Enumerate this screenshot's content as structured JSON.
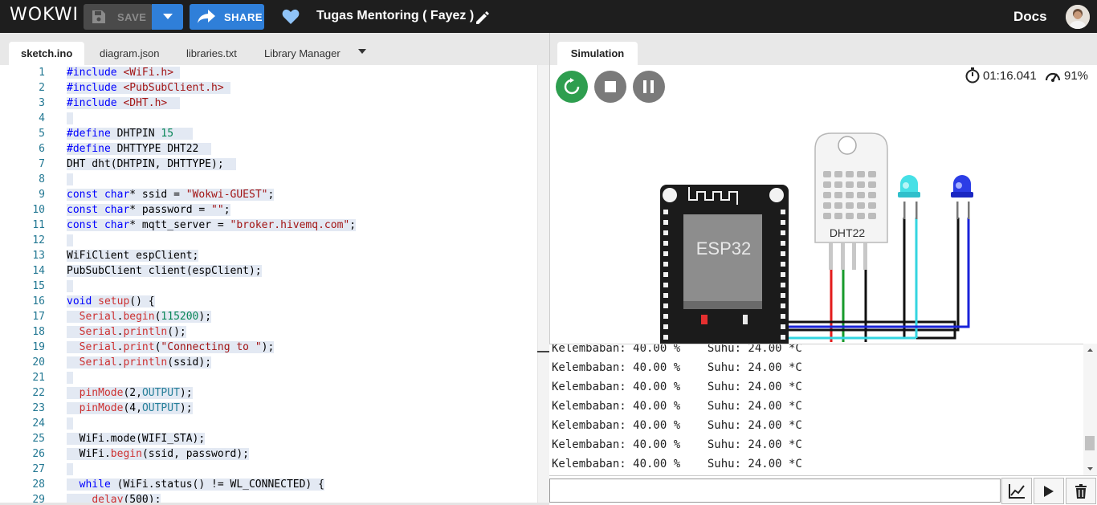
{
  "header": {
    "logo": "WOKWI",
    "save_label": "SAVE",
    "share_label": "SHARE",
    "project_title": "Tugas Mentoring ( Fayez )",
    "docs_label": "Docs"
  },
  "editor_tabs": [
    {
      "label": "sketch.ino",
      "active": true
    },
    {
      "label": "diagram.json",
      "active": false
    },
    {
      "label": "libraries.txt",
      "active": false
    },
    {
      "label": "Library Manager",
      "active": false
    }
  ],
  "code_lines": [
    {
      "n": "1",
      "segs": [
        [
          "kw",
          "#include"
        ],
        [
          "",
          " "
        ],
        [
          "str",
          "<WiFi.h>"
        ],
        [
          "",
          " "
        ]
      ]
    },
    {
      "n": "2",
      "segs": [
        [
          "kw",
          "#include"
        ],
        [
          "",
          " "
        ],
        [
          "str",
          "<PubSubClient.h>"
        ],
        [
          "",
          " "
        ]
      ]
    },
    {
      "n": "3",
      "segs": [
        [
          "kw",
          "#include"
        ],
        [
          "",
          " "
        ],
        [
          "str",
          "<DHT.h>"
        ],
        [
          "",
          "  "
        ]
      ]
    },
    {
      "n": "4",
      "segs": [
        [
          "",
          " "
        ]
      ]
    },
    {
      "n": "5",
      "segs": [
        [
          "kw",
          "#define"
        ],
        [
          "",
          " DHTPIN "
        ],
        [
          "num",
          "15"
        ],
        [
          "",
          "   "
        ]
      ]
    },
    {
      "n": "6",
      "segs": [
        [
          "kw",
          "#define"
        ],
        [
          "",
          " DHTTYPE DHT22  "
        ]
      ]
    },
    {
      "n": "7",
      "segs": [
        [
          "",
          "DHT dht(DHTPIN, DHTTYPE);  "
        ]
      ]
    },
    {
      "n": "8",
      "segs": [
        [
          "",
          " "
        ]
      ]
    },
    {
      "n": "9",
      "segs": [
        [
          "kw",
          "const"
        ],
        [
          "",
          " "
        ],
        [
          "kw",
          "char"
        ],
        [
          "",
          "* ssid = "
        ],
        [
          "str",
          "\"Wokwi-GUEST\""
        ],
        [
          "",
          ";"
        ]
      ]
    },
    {
      "n": "10",
      "segs": [
        [
          "kw",
          "const"
        ],
        [
          "",
          " "
        ],
        [
          "kw",
          "char"
        ],
        [
          "",
          "* password = "
        ],
        [
          "str",
          "\"\""
        ],
        [
          "",
          ";"
        ]
      ]
    },
    {
      "n": "11",
      "segs": [
        [
          "kw",
          "const"
        ],
        [
          "",
          " "
        ],
        [
          "kw",
          "char"
        ],
        [
          "",
          "* mqtt_server = "
        ],
        [
          "str",
          "\"broker.hivemq.com\""
        ],
        [
          "",
          ";"
        ]
      ]
    },
    {
      "n": "12",
      "segs": [
        [
          "",
          " "
        ]
      ]
    },
    {
      "n": "13",
      "segs": [
        [
          "",
          "WiFiClient espClient;"
        ]
      ]
    },
    {
      "n": "14",
      "segs": [
        [
          "",
          "PubSubClient client(espClient);"
        ]
      ]
    },
    {
      "n": "15",
      "segs": [
        [
          "",
          " "
        ]
      ]
    },
    {
      "n": "16",
      "segs": [
        [
          "kw",
          "void"
        ],
        [
          "",
          " "
        ],
        [
          "fn",
          "setup"
        ],
        [
          "",
          "() {"
        ]
      ]
    },
    {
      "n": "17",
      "segs": [
        [
          "",
          "  "
        ],
        [
          "fn",
          "Serial"
        ],
        [
          "",
          "."
        ],
        [
          "fn",
          "begin"
        ],
        [
          "",
          "("
        ],
        [
          "num",
          "115200"
        ],
        [
          "",
          ");"
        ]
      ]
    },
    {
      "n": "18",
      "segs": [
        [
          "",
          "  "
        ],
        [
          "fn",
          "Serial"
        ],
        [
          "",
          "."
        ],
        [
          "fn",
          "println"
        ],
        [
          "",
          "();"
        ]
      ]
    },
    {
      "n": "19",
      "segs": [
        [
          "",
          "  "
        ],
        [
          "fn",
          "Serial"
        ],
        [
          "",
          "."
        ],
        [
          "fn",
          "print"
        ],
        [
          "",
          "("
        ],
        [
          "str",
          "\"Connecting to \""
        ],
        [
          "",
          ");"
        ]
      ]
    },
    {
      "n": "20",
      "segs": [
        [
          "",
          "  "
        ],
        [
          "fn",
          "Serial"
        ],
        [
          "",
          "."
        ],
        [
          "fn",
          "println"
        ],
        [
          "",
          "(ssid);"
        ]
      ]
    },
    {
      "n": "21",
      "segs": [
        [
          "",
          " "
        ]
      ]
    },
    {
      "n": "22",
      "segs": [
        [
          "",
          "  "
        ],
        [
          "fn",
          "pinMode"
        ],
        [
          "",
          "(2,"
        ],
        [
          "ty",
          "OUTPUT"
        ],
        [
          "",
          ");"
        ]
      ]
    },
    {
      "n": "23",
      "segs": [
        [
          "",
          "  "
        ],
        [
          "fn",
          "pinMode"
        ],
        [
          "",
          "(4,"
        ],
        [
          "ty",
          "OUTPUT"
        ],
        [
          "",
          ");"
        ]
      ]
    },
    {
      "n": "24",
      "segs": [
        [
          "",
          " "
        ]
      ]
    },
    {
      "n": "25",
      "segs": [
        [
          "",
          "  WiFi.mode(WIFI_STA);"
        ]
      ]
    },
    {
      "n": "26",
      "segs": [
        [
          "",
          "  WiFi."
        ],
        [
          "fn",
          "begin"
        ],
        [
          "",
          "(ssid, password);"
        ]
      ]
    },
    {
      "n": "27",
      "segs": [
        [
          "",
          " "
        ]
      ]
    },
    {
      "n": "28",
      "segs": [
        [
          "",
          "  "
        ],
        [
          "kw",
          "while"
        ],
        [
          "",
          " (WiFi.status() != WL_CONNECTED) {"
        ]
      ]
    },
    {
      "n": "29",
      "segs": [
        [
          "",
          "    "
        ],
        [
          "fn",
          "delay"
        ],
        [
          "",
          "(500);"
        ]
      ]
    }
  ],
  "simulation": {
    "tab_label": "Simulation",
    "timer": "01:16.041",
    "speed": "91%",
    "esp_label": "ESP32",
    "dht_label": "DHT22"
  },
  "serial_lines": [
    "Kelembaban: 40.00 %    Suhu: 24.00 *C",
    "Kelembaban: 40.00 %    Suhu: 24.00 *C",
    "Kelembaban: 40.00 %    Suhu: 24.00 *C",
    "Kelembaban: 40.00 %    Suhu: 24.00 *C",
    "Kelembaban: 40.00 %    Suhu: 24.00 *C",
    "Kelembaban: 40.00 %    Suhu: 24.00 *C",
    "Kelembaban: 40.00 %    Suhu: 24.00 *C"
  ],
  "serial_input": {
    "value": ""
  },
  "colors": {
    "topbar": "#1e1e1e",
    "accent": "#2f7fd9",
    "play_green": "#2e9e4f"
  }
}
